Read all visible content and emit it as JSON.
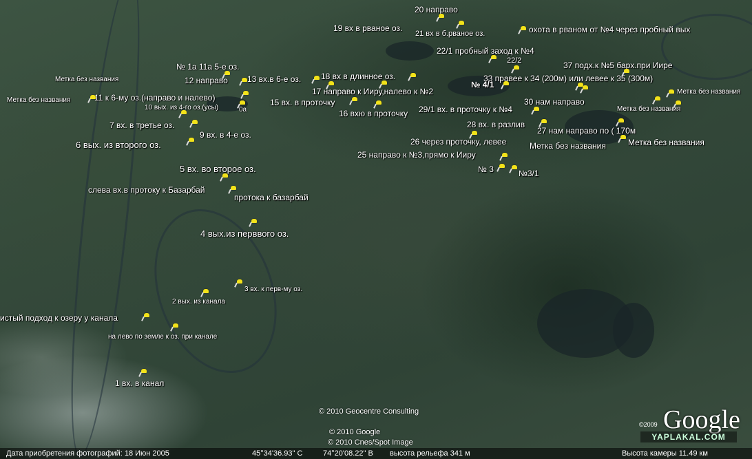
{
  "labels": [
    {
      "id": "l20",
      "text": "20  направо"
    },
    {
      "id": "l19",
      "text": "19  вх в рваное оз."
    },
    {
      "id": "l21",
      "text": "21  вх в б.рваное оз."
    },
    {
      "id": "lhunt",
      "text": "охота в рваном от №4 через пробный вых"
    },
    {
      "id": "l22_1",
      "text": "22/1 пробный заход к №4"
    },
    {
      "id": "l22_2",
      "text": "22/2"
    },
    {
      "id": "l37",
      "text": "37 подх.к №5 барх.при Иире"
    },
    {
      "id": "l33",
      "text": "33 правее к 34 (200м)  или левее к 35 (300м)"
    },
    {
      "id": "l4_1",
      "text": "№ 4/1"
    },
    {
      "id": "lm1",
      "text": "Метка без названия"
    },
    {
      "id": "lm2",
      "text": "Метка без названия"
    },
    {
      "id": "lm3",
      "text": "Метка без названия"
    },
    {
      "id": "lm4",
      "text": "Метка без названия"
    },
    {
      "id": "lm5",
      "text": "Метка без названия"
    },
    {
      "id": "lm6",
      "text": "Метка без названия"
    },
    {
      "id": "l30",
      "text": "30 нам направо"
    },
    {
      "id": "l29_1",
      "text": "29/1  вх. в проточку к №4"
    },
    {
      "id": "l28",
      "text": "28 вх. в разлив"
    },
    {
      "id": "l27",
      "text": "27 нам направо по ( 170м"
    },
    {
      "id": "l26",
      "text": "26 через проточку, левее"
    },
    {
      "id": "l25",
      "text": "25 направо к №3,прямо к Ииру"
    },
    {
      "id": "l3",
      "text": "№ 3"
    },
    {
      "id": "l3_1",
      "text": "№3/1"
    },
    {
      "id": "l18",
      "text": "18 вх в длинное оз."
    },
    {
      "id": "l17",
      "text": "17 направо к Ииру,налево к №2"
    },
    {
      "id": "l15",
      "text": "15  вх. в проточку"
    },
    {
      "id": "l16",
      "text": "16  вхю в проточку"
    },
    {
      "id": "l1a",
      "text": "№ 1а  11а  5-е оз."
    },
    {
      "id": "l12",
      "text": "12  направо"
    },
    {
      "id": "l13",
      "text": "13  вх.в 6-е оз."
    },
    {
      "id": "l11",
      "text": "11 к 6-му оз.(направо и налево)"
    },
    {
      "id": "l10",
      "text": "10 вых. из 4-го оз.(усы)"
    },
    {
      "id": "l10a",
      "text": "0а"
    },
    {
      "id": "l7",
      "text": "7  вх. в третье оз."
    },
    {
      "id": "l9",
      "text": "9 вх. в 4-е оз."
    },
    {
      "id": "l6",
      "text": "6  вых. из второго оз."
    },
    {
      "id": "l5",
      "text": "5 вх. во второе оз."
    },
    {
      "id": "lleft",
      "text": "слева вх.в  протоку к Базарбай"
    },
    {
      "id": "lprot",
      "text": "протока к базарбай"
    },
    {
      "id": "l4",
      "text": "4 вых.из перввого оз."
    },
    {
      "id": "l3p",
      "text": "3 вх. к перв-му оз."
    },
    {
      "id": "l2",
      "text": "2 вых. из канала"
    },
    {
      "id": "lclean",
      "text": "истый подход к озеру у канала"
    },
    {
      "id": "lleft2",
      "text": "на лево по земле к оз. при канале"
    },
    {
      "id": "l1",
      "text": "1 вх. в канал"
    }
  ],
  "credits": {
    "geocentre": "© 2010 Geocentre Consulting",
    "google": "© 2010 Google",
    "cnes": "© 2010 Cnes/Spot Image"
  },
  "logo": {
    "text": "Google",
    "year": "©2009"
  },
  "watermark": "YAPLAKAL.COM",
  "statusbar": {
    "photo_date": "Дата приобретения фотографий: 18 Июн 2005",
    "lat": "45°34'36.93\" С",
    "lon": "74°20'08.22\" В",
    "elevation": "высота рельефа  341 м",
    "camera": "Высота камеры    11.49 км"
  }
}
